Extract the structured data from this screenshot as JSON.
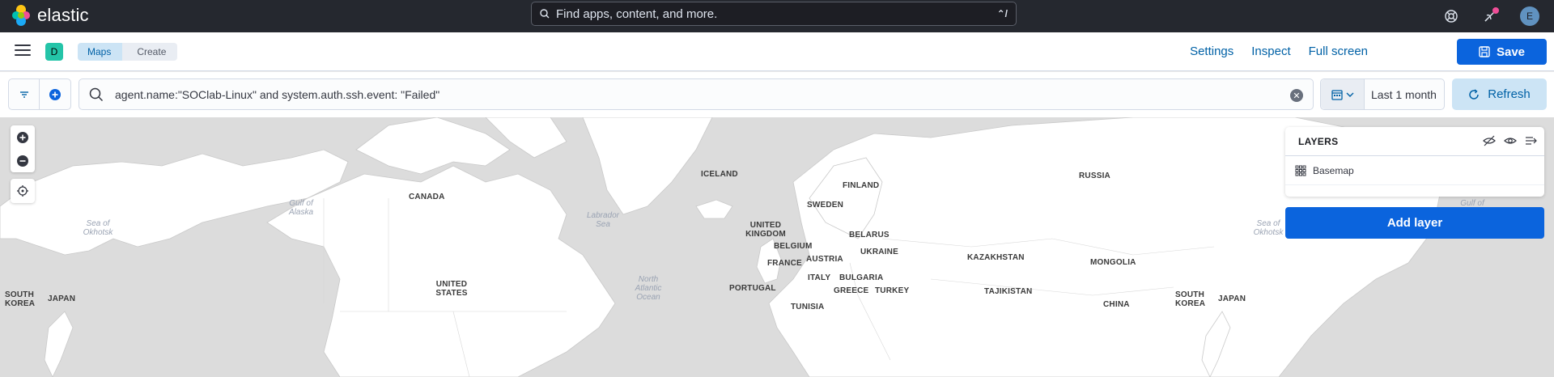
{
  "header": {
    "brand": "elastic",
    "search_placeholder": "Find apps, content, and more.",
    "search_shortcut": "⌃/",
    "avatar_initial": "E",
    "icons": [
      "help-icon",
      "newsfeed-icon",
      "user-avatar"
    ]
  },
  "nav": {
    "space_initial": "D",
    "breadcrumbs": [
      "Maps",
      "Create"
    ],
    "links": [
      "Settings",
      "Inspect",
      "Full screen"
    ],
    "save_label": "Save"
  },
  "query": {
    "text": "agent.name:\"SOClab-Linux\" and system.auth.ssh.event: \"Failed\"",
    "date_range": "Last 1 month",
    "refresh_label": "Refresh"
  },
  "layers": {
    "title": "LAYERS",
    "items": [
      {
        "name": "Basemap"
      }
    ],
    "add_label": "Add layer"
  },
  "map_labels": {
    "countries": [
      "CANADA",
      "ICELAND",
      "FINLAND",
      "SWEDEN",
      "RUSSIA",
      "UNITED KINGDOM",
      "BELARUS",
      "BELGIUM",
      "UKRAINE",
      "FRANCE",
      "AUSTRIA",
      "KAZAKHSTAN",
      "MONGOLIA",
      "ITALY",
      "BULGARIA",
      "UNITED STATES",
      "PORTUGAL",
      "GREECE",
      "TURKEY",
      "TAJIKISTAN",
      "SOUTH KOREA",
      "JAPAN",
      "CHINA",
      "TUNISIA"
    ],
    "seas": [
      "Gulf of Alaska",
      "Sea of Okhotsk",
      "Labrador Sea",
      "North Atlantic Ocean"
    ]
  },
  "colors": {
    "header_bg": "#25282f",
    "primary": "#0b64dd",
    "link": "#0061a6",
    "space_badge": "#24c4a8",
    "map_land": "#ffffff",
    "map_water": "#dcdcdc"
  }
}
